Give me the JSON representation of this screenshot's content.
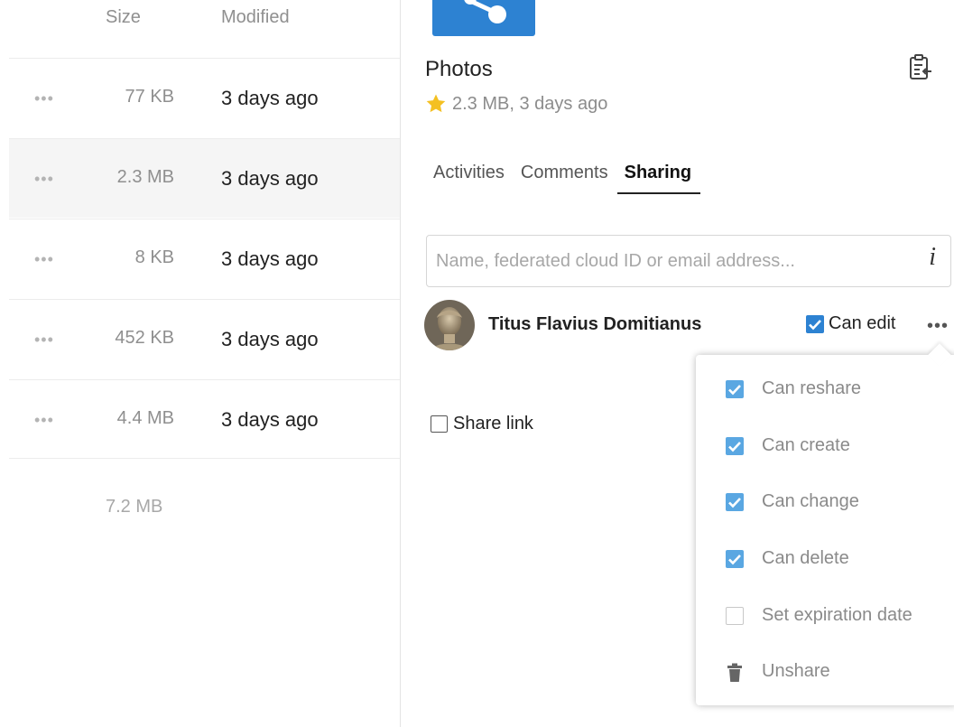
{
  "file_list": {
    "columns": {
      "size": "Size",
      "modified": "Modified"
    },
    "rows": [
      {
        "actions": "•••",
        "size": "77 KB",
        "modified": "3 days ago"
      },
      {
        "actions": "•••",
        "size": "2.3 MB",
        "modified": "3 days ago"
      },
      {
        "actions": "•••",
        "size": "8 KB",
        "modified": "3 days ago"
      },
      {
        "actions": "•••",
        "size": "452 KB",
        "modified": "3 days ago"
      },
      {
        "actions": "•••",
        "size": "4.4 MB",
        "modified": "3 days ago"
      }
    ],
    "total_size": "7.2 MB"
  },
  "sidebar": {
    "file_name": "Photos",
    "meta": "2.3 MB, 3 days ago",
    "favorite": true,
    "tabs": [
      {
        "label": "Activities",
        "active": false
      },
      {
        "label": "Comments",
        "active": false
      },
      {
        "label": "Sharing",
        "active": true
      }
    ],
    "share_input": {
      "placeholder": "Name, federated cloud ID or email address...",
      "value": ""
    },
    "info_icon": "i",
    "share_entry": {
      "user": "Titus Flavius Domitianus",
      "can_edit_label": "Can edit",
      "can_edit_checked": true,
      "menu_icon": "•••"
    },
    "share_link": {
      "label": "Share link",
      "checked": false
    },
    "share_menu": [
      {
        "label": "Can reshare",
        "icon": "checkbox-checked",
        "checked": true
      },
      {
        "label": "Can create",
        "icon": "checkbox-checked",
        "checked": true
      },
      {
        "label": "Can change",
        "icon": "checkbox-checked",
        "checked": true
      },
      {
        "label": "Can delete",
        "icon": "checkbox-checked",
        "checked": true
      },
      {
        "label": "Set expiration date",
        "icon": "checkbox-empty",
        "checked": false
      },
      {
        "label": "Unshare",
        "icon": "trash-icon"
      }
    ]
  },
  "colors": {
    "accent_blue": "#2d82d2",
    "menu_checkbox_blue": "#5aa7e2",
    "star_yellow": "#f4c022",
    "muted_text": "#8a8a8a"
  }
}
